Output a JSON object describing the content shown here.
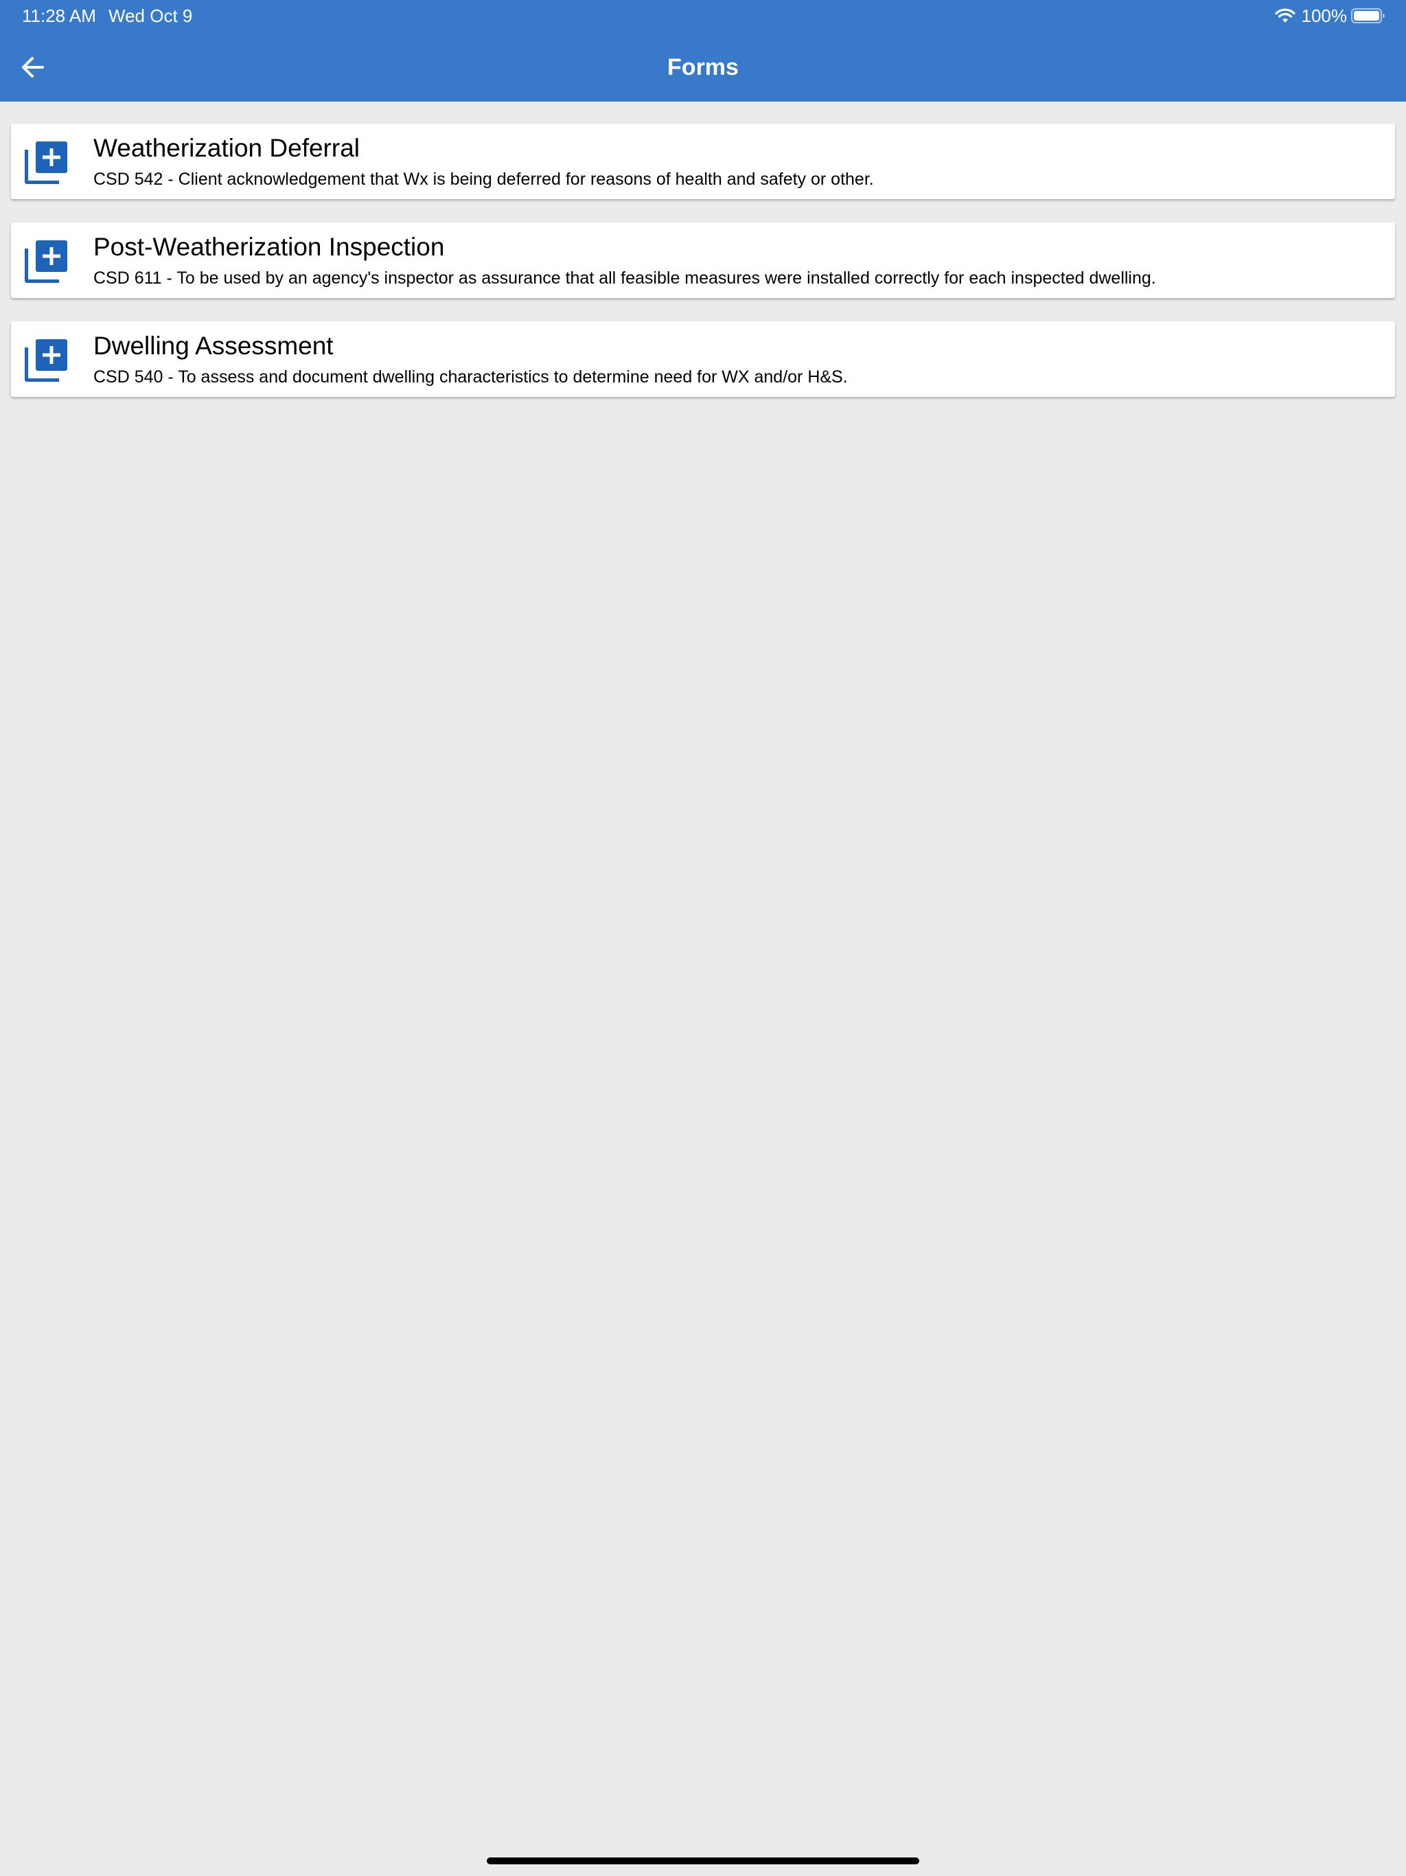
{
  "status_bar": {
    "time": "11:28 AM",
    "date": "Wed Oct 9",
    "battery": "100%"
  },
  "header": {
    "title": "Forms",
    "back_icon": "arrow-left-icon"
  },
  "forms": [
    {
      "title": "Weatherization Deferral",
      "description": "CSD 542 - Client acknowledgement that Wx is being deferred for reasons of health and safety or other.",
      "icon": "library-add-icon"
    },
    {
      "title": "Post-Weatherization Inspection",
      "description": "CSD 611 - To be used by an agency's inspector as assurance that all feasible measures were installed correctly for each inspected dwelling.",
      "icon": "library-add-icon"
    },
    {
      "title": "Dwelling Assessment",
      "description": "CSD 540 - To assess and document dwelling characteristics to determine need for WX and/or H&S.",
      "icon": "library-add-icon"
    }
  ],
  "colors": {
    "app_bar": "#387ac9",
    "icon": "#1f63b8",
    "background": "#ebebeb",
    "card": "#ffffff"
  }
}
